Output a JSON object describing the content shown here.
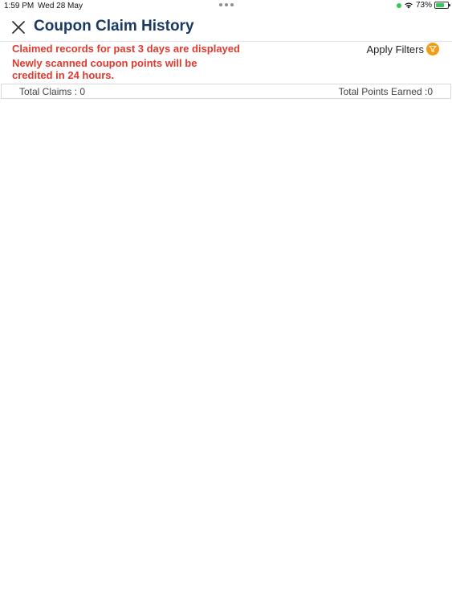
{
  "status_bar": {
    "time": "1:59 PM",
    "date": "Wed 28 May",
    "battery_percent": "73%",
    "battery_level": 0.73
  },
  "header": {
    "title": "Coupon Claim History"
  },
  "notices": {
    "line1": "Claimed records for past 3 days are displayed",
    "line2": "Newly scanned coupon points will be credited in 24 hours."
  },
  "filters": {
    "label": "Apply Filters"
  },
  "totals": {
    "claims": "Total Claims : 0",
    "points": "Total Points Earned :0"
  },
  "colors": {
    "title": "#1a3a66",
    "notice": "#e03a2e",
    "filter_accent": "#f39c12"
  }
}
